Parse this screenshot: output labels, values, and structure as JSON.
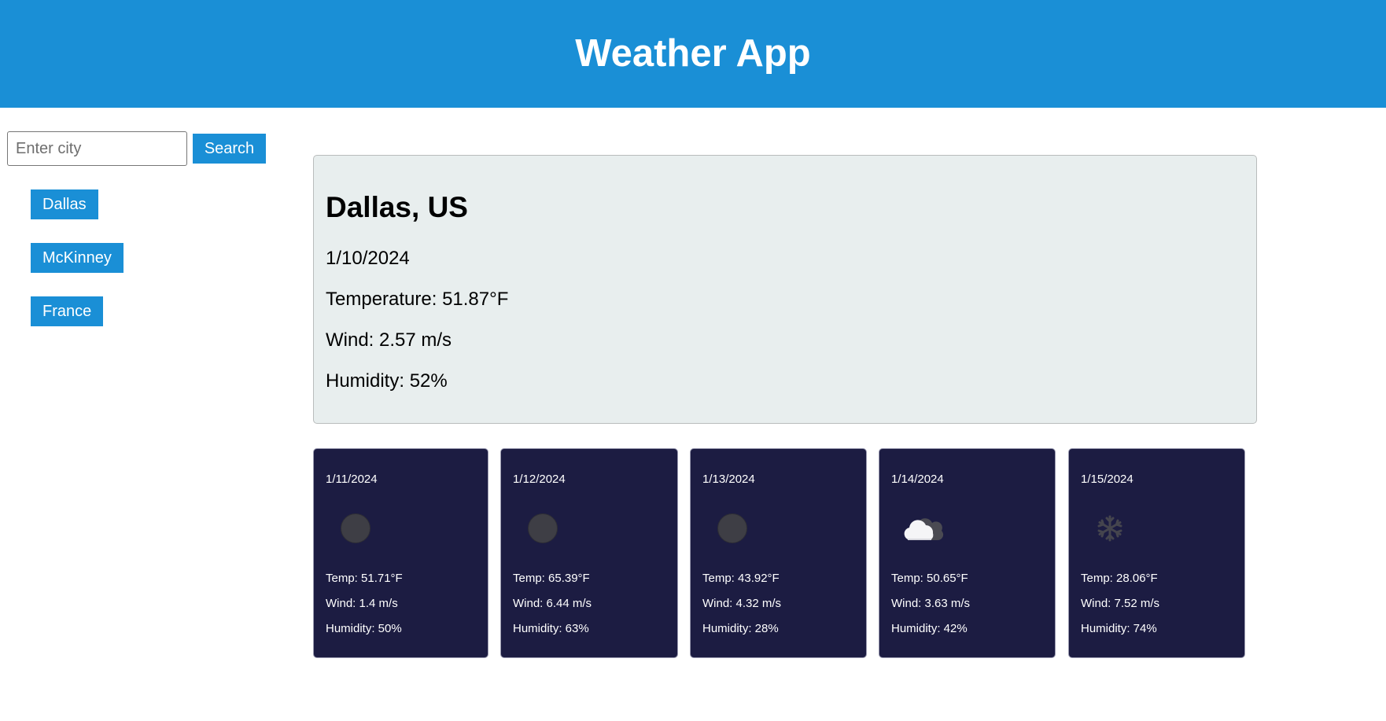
{
  "app": {
    "title": "Weather App"
  },
  "search": {
    "placeholder": "Enter city",
    "value": "",
    "button_label": "Search"
  },
  "history": [
    "Dallas",
    "McKinney",
    "France"
  ],
  "current": {
    "city": "Dallas, US",
    "date": "1/10/2024",
    "temperature": "Temperature: 51.87°F",
    "wind": "Wind: 2.57 m/s",
    "humidity": "Humidity: 52%"
  },
  "forecast": [
    {
      "date": "1/11/2024",
      "icon": "night-clear-icon",
      "temp": "Temp: 51.71°F",
      "wind": "Wind: 1.4 m/s",
      "humidity": "Humidity: 50%"
    },
    {
      "date": "1/12/2024",
      "icon": "night-clear-icon",
      "temp": "Temp: 65.39°F",
      "wind": "Wind: 6.44 m/s",
      "humidity": "Humidity: 63%"
    },
    {
      "date": "1/13/2024",
      "icon": "night-clear-icon",
      "temp": "Temp: 43.92°F",
      "wind": "Wind: 4.32 m/s",
      "humidity": "Humidity: 28%"
    },
    {
      "date": "1/14/2024",
      "icon": "broken-clouds-icon",
      "temp": "Temp: 50.65°F",
      "wind": "Wind: 3.63 m/s",
      "humidity": "Humidity: 42%"
    },
    {
      "date": "1/15/2024",
      "icon": "snow-icon",
      "temp": "Temp: 28.06°F",
      "wind": "Wind: 7.52 m/s",
      "humidity": "Humidity: 74%"
    }
  ],
  "colors": {
    "accent": "#1a8fd6",
    "card": "#1c1c42",
    "current_bg": "#e8eeee"
  }
}
